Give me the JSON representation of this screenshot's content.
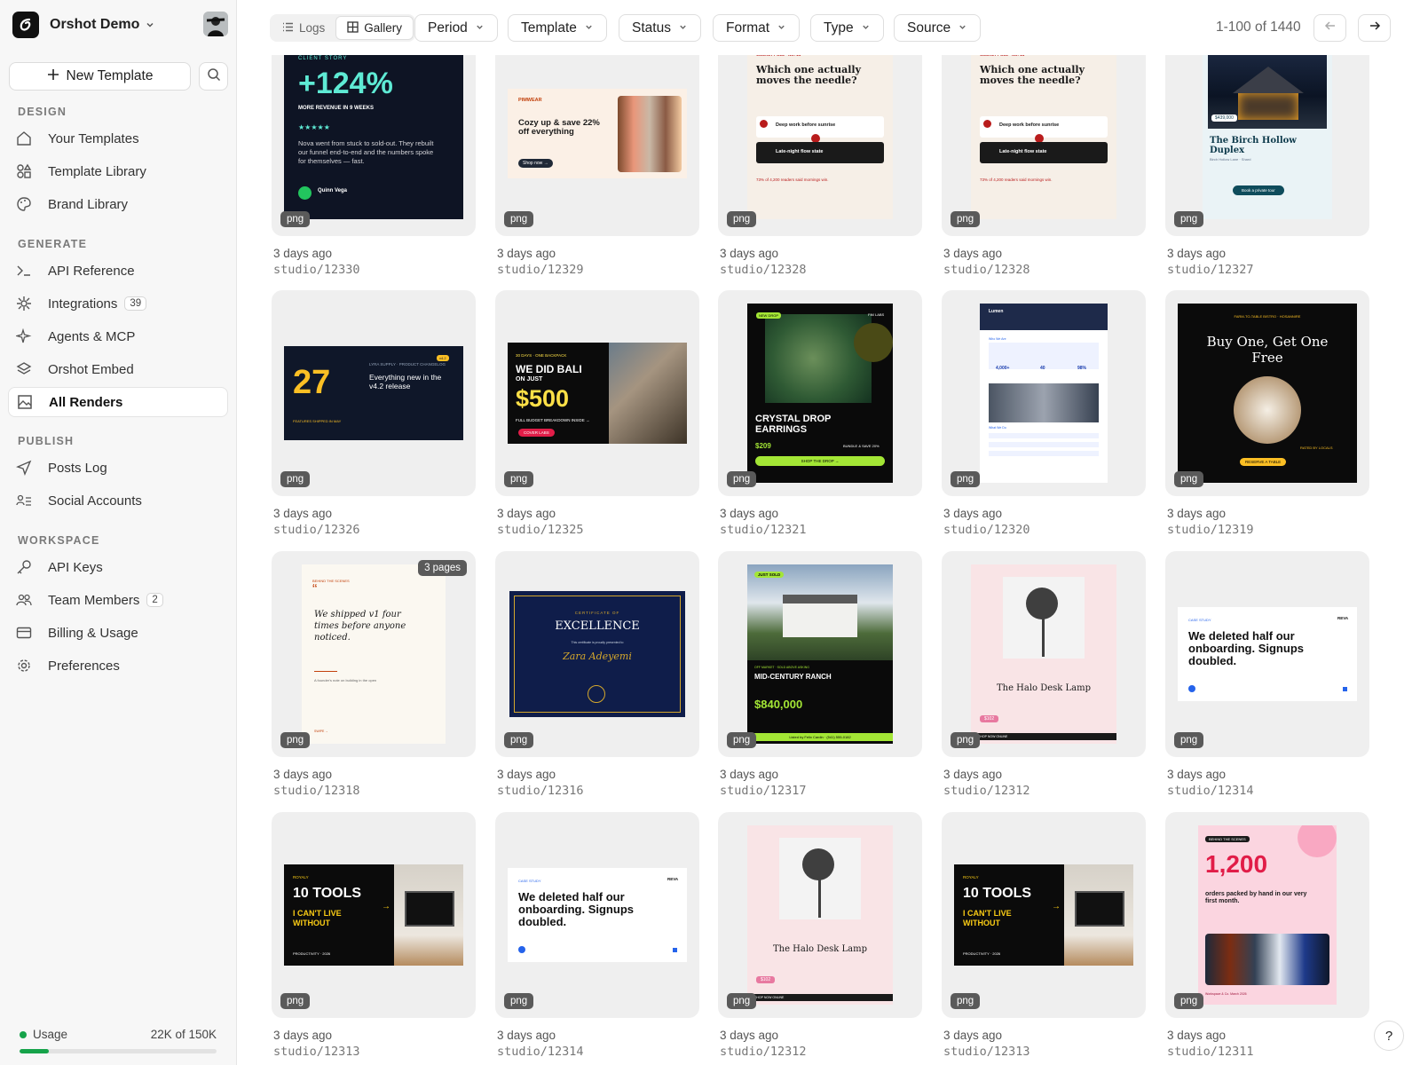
{
  "workspace": {
    "name": "Orshot Demo"
  },
  "sidebar": {
    "new_template": "New Template",
    "sections": [
      {
        "title": "DESIGN",
        "items": [
          {
            "label": "Your Templates",
            "icon": "home-icon"
          },
          {
            "label": "Template Library",
            "icon": "shapes-icon"
          },
          {
            "label": "Brand Library",
            "icon": "palette-icon"
          }
        ]
      },
      {
        "title": "GENERATE",
        "items": [
          {
            "label": "API Reference",
            "icon": "terminal-icon"
          },
          {
            "label": "Integrations",
            "icon": "integrations-icon",
            "count": "39"
          },
          {
            "label": "Agents & MCP",
            "icon": "sparkles-icon"
          },
          {
            "label": "Orshot Embed",
            "icon": "layers-icon"
          },
          {
            "label": "All Renders",
            "icon": "image-icon",
            "active": true
          }
        ]
      },
      {
        "title": "PUBLISH",
        "items": [
          {
            "label": "Posts Log",
            "icon": "send-icon"
          },
          {
            "label": "Social Accounts",
            "icon": "user-list-icon"
          }
        ]
      },
      {
        "title": "WORKSPACE",
        "items": [
          {
            "label": "API Keys",
            "icon": "key-icon"
          },
          {
            "label": "Team Members",
            "icon": "users-icon",
            "count": "2"
          },
          {
            "label": "Billing & Usage",
            "icon": "card-icon"
          },
          {
            "label": "Preferences",
            "icon": "gear-icon"
          }
        ]
      }
    ],
    "usage": {
      "label": "Usage",
      "value": "22K of 150K",
      "fraction": 0.147
    }
  },
  "toolbar": {
    "tabs": [
      {
        "label": "Logs",
        "icon": "list-icon"
      },
      {
        "label": "Gallery",
        "icon": "grid-icon",
        "active": true
      }
    ],
    "filters": [
      "Period",
      "Template",
      "Status",
      "Format",
      "Type",
      "Source"
    ],
    "pagination": "1-100 of 1440"
  },
  "renders": [
    {
      "time": "3 days ago",
      "id": "studio/12330",
      "format": "png",
      "theme": "dark-stat",
      "texts": [
        "CLIENT STORY",
        "+124%",
        "MORE REVENUE IN 9 WEEKS",
        "★★★★★",
        "Nova went from stuck to sold-out. They rebuilt our funnel end-to-end and the numbers spoke for themselves — fast.",
        "Quinn Vega"
      ]
    },
    {
      "time": "3 days ago",
      "id": "studio/12329",
      "format": "png",
      "theme": "cream-banner",
      "texts": [
        "PIMWEAR",
        "Cozy up & save 22% off everything",
        "Shop now →"
      ]
    },
    {
      "time": "3 days ago",
      "id": "studio/12328",
      "format": "png",
      "theme": "poll",
      "texts": [
        "WEEKLY POLL · NO. 14",
        "Which one actually moves the needle?",
        "Deep work before sunrise",
        "Late-night flow state",
        "73% of 4,200 readers said mornings win."
      ]
    },
    {
      "time": "3 days ago",
      "id": "studio/12328",
      "format": "png",
      "theme": "poll",
      "texts": [
        "WEEKLY POLL · NO. 14",
        "Which one actually moves the needle?",
        "Deep work before sunrise",
        "Late-night flow state",
        "73% of 4,200 readers said mornings win."
      ]
    },
    {
      "time": "3 days ago",
      "id": "studio/12327",
      "format": "png",
      "theme": "house",
      "texts": [
        "COMING SOON",
        "$439,000",
        "The Birch Hollow Duplex",
        "Birch Hollow Lane · Shard",
        "Book a private tour"
      ]
    },
    {
      "time": "3 days ago",
      "id": "studio/12326",
      "format": "png",
      "theme": "dark-banner",
      "texts": [
        "27",
        "LYRA SUPPLY · PRODUCT CHANGELOG",
        "Everything new in the v4.2 release",
        "FEATURES SHIPPED IN MAY",
        "v4.2"
      ]
    },
    {
      "time": "3 days ago",
      "id": "studio/12325",
      "format": "png",
      "theme": "bali",
      "texts": [
        "30 DAYS · ONE BACKPACK",
        "WE DID BALI",
        "ON JUST",
        "$500",
        "FULL BUDGET BREAKDOWN INSIDE →",
        "COVER LABS"
      ]
    },
    {
      "time": "3 days ago",
      "id": "studio/12321",
      "format": "png",
      "theme": "earrings",
      "texts": [
        "NEW DROP",
        "FIM LABS",
        "CRYSTAL DROP EARRINGS",
        "$209",
        "BUNDLE & SAVE 20%",
        "SHOP THE DROP →"
      ]
    },
    {
      "time": "3 days ago",
      "id": "studio/12320",
      "format": "png",
      "theme": "report",
      "texts": [
        "Lumen",
        "Who We Are",
        "4,000+",
        "40",
        "98%",
        "What We Do"
      ]
    },
    {
      "time": "3 days ago",
      "id": "studio/12319",
      "format": "png",
      "theme": "restaurant",
      "texts": [
        "FARM-TO-TABLE BISTRO · HOSANNIRE",
        "Buy One, Get One Free",
        "RATED BY LOCALS",
        "RESERVE A TABLE"
      ]
    },
    {
      "time": "3 days ago",
      "id": "studio/12318",
      "format": "png",
      "theme": "quote",
      "pages": "3 pages",
      "texts": [
        "BEHIND THE SCENES",
        "We shipped v1 four times before anyone noticed.",
        "A founder's note on building in the open",
        "SWIPE →"
      ]
    },
    {
      "time": "3 days ago",
      "id": "studio/12316",
      "format": "png",
      "theme": "certificate",
      "texts": [
        "CERTIFICATE OF",
        "EXCELLENCE",
        "This certificate is proudly presented to",
        "Zara Adeyemi"
      ]
    },
    {
      "time": "3 days ago",
      "id": "studio/12317",
      "format": "png",
      "theme": "ranch",
      "texts": [
        "JUST SOLD",
        "MID-CENTURY RANCH",
        "$840,000",
        "OFF MARKET · SOLD ABOVE ASKING",
        "Listed by Felix Cardin · (541) 555-0182"
      ]
    },
    {
      "time": "3 days ago",
      "id": "studio/12312",
      "format": "png",
      "theme": "lamp",
      "texts": [
        "The Halo Desk Lamp",
        "$102",
        "SHOP NOW ONLINE"
      ]
    },
    {
      "time": "3 days ago",
      "id": "studio/12314",
      "format": "png",
      "theme": "case",
      "texts": [
        "CASE STUDY",
        "REVA",
        "We deleted half our onboarding. Signups doubled."
      ]
    },
    {
      "time": "3 days ago",
      "id": "studio/12313",
      "format": "png",
      "theme": "tools",
      "texts": [
        "ROYALY",
        "10 TOOLS",
        "I CAN'T LIVE WITHOUT",
        "PRODUCTIVITY · 2026"
      ]
    },
    {
      "time": "3 days ago",
      "id": "studio/12314",
      "format": "png",
      "theme": "case",
      "texts": [
        "CASE STUDY",
        "REVA",
        "We deleted half our onboarding. Signups doubled."
      ]
    },
    {
      "time": "3 days ago",
      "id": "studio/12312",
      "format": "png",
      "theme": "lamp",
      "texts": [
        "The Halo Desk Lamp",
        "$102",
        "SHOP NOW ONLINE"
      ]
    },
    {
      "time": "3 days ago",
      "id": "studio/12313",
      "format": "png",
      "theme": "tools",
      "texts": [
        "ROYALY",
        "10 TOOLS",
        "I CAN'T LIVE WITHOUT",
        "PRODUCTIVITY · 2026"
      ]
    },
    {
      "time": "3 days ago",
      "id": "studio/12311",
      "format": "png",
      "theme": "orders",
      "texts": [
        "BEHIND THE SCENES",
        "1,200",
        "orders packed by hand in our very first month.",
        "Workspace & Co. March 2026"
      ]
    }
  ],
  "help": {
    "label": "?"
  }
}
